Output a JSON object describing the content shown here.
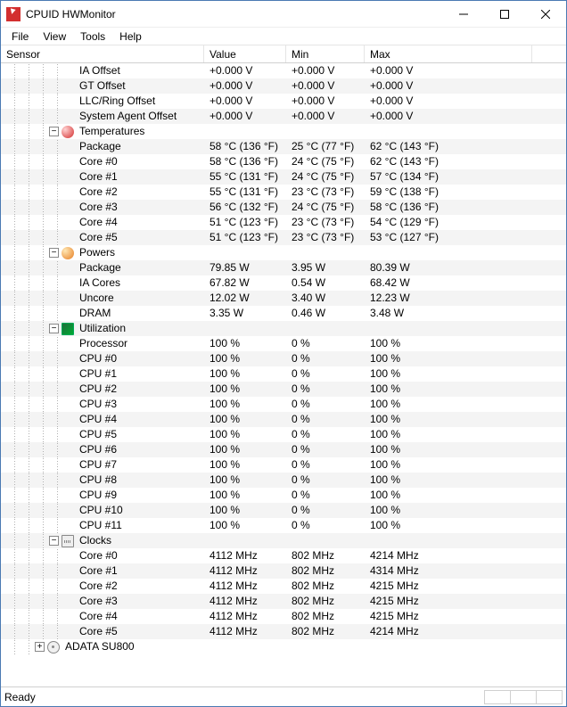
{
  "window": {
    "title": "CPUID HWMonitor"
  },
  "menu": {
    "file": "File",
    "view": "View",
    "tools": "Tools",
    "help": "Help"
  },
  "columns": {
    "sensor": "Sensor",
    "value": "Value",
    "min": "Min",
    "max": "Max"
  },
  "status": {
    "text": "Ready"
  },
  "rows": [
    {
      "kind": "leaf",
      "depth": 4,
      "label": "IA Offset",
      "value": "+0.000 V",
      "min": "+0.000 V",
      "max": "+0.000 V"
    },
    {
      "kind": "leaf",
      "depth": 4,
      "label": "GT Offset",
      "value": "+0.000 V",
      "min": "+0.000 V",
      "max": "+0.000 V"
    },
    {
      "kind": "leaf",
      "depth": 4,
      "label": "LLC/Ring Offset",
      "value": "+0.000 V",
      "min": "+0.000 V",
      "max": "+0.000 V"
    },
    {
      "kind": "leaf",
      "depth": 4,
      "label": "System Agent Offset",
      "value": "+0.000 V",
      "min": "+0.000 V",
      "max": "+0.000 V"
    },
    {
      "kind": "cat",
      "depth": 3,
      "icon": "temp",
      "label": "Temperatures"
    },
    {
      "kind": "leaf",
      "depth": 4,
      "label": "Package",
      "value": "58 °C  (136 °F)",
      "min": "25 °C  (77 °F)",
      "max": "62 °C  (143 °F)"
    },
    {
      "kind": "leaf",
      "depth": 4,
      "label": "Core #0",
      "value": "58 °C  (136 °F)",
      "min": "24 °C  (75 °F)",
      "max": "62 °C  (143 °F)"
    },
    {
      "kind": "leaf",
      "depth": 4,
      "label": "Core #1",
      "value": "55 °C  (131 °F)",
      "min": "24 °C  (75 °F)",
      "max": "57 °C  (134 °F)"
    },
    {
      "kind": "leaf",
      "depth": 4,
      "label": "Core #2",
      "value": "55 °C  (131 °F)",
      "min": "23 °C  (73 °F)",
      "max": "59 °C  (138 °F)"
    },
    {
      "kind": "leaf",
      "depth": 4,
      "label": "Core #3",
      "value": "56 °C  (132 °F)",
      "min": "24 °C  (75 °F)",
      "max": "58 °C  (136 °F)"
    },
    {
      "kind": "leaf",
      "depth": 4,
      "label": "Core #4",
      "value": "51 °C  (123 °F)",
      "min": "23 °C  (73 °F)",
      "max": "54 °C  (129 °F)"
    },
    {
      "kind": "leaf",
      "depth": 4,
      "label": "Core #5",
      "value": "51 °C  (123 °F)",
      "min": "23 °C  (73 °F)",
      "max": "53 °C  (127 °F)"
    },
    {
      "kind": "cat",
      "depth": 3,
      "icon": "power",
      "label": "Powers"
    },
    {
      "kind": "leaf",
      "depth": 4,
      "label": "Package",
      "value": "79.85 W",
      "min": "3.95 W",
      "max": "80.39 W"
    },
    {
      "kind": "leaf",
      "depth": 4,
      "label": "IA Cores",
      "value": "67.82 W",
      "min": "0.54 W",
      "max": "68.42 W"
    },
    {
      "kind": "leaf",
      "depth": 4,
      "label": "Uncore",
      "value": "12.02 W",
      "min": "3.40 W",
      "max": "12.23 W"
    },
    {
      "kind": "leaf",
      "depth": 4,
      "label": "DRAM",
      "value": "3.35 W",
      "min": "0.46 W",
      "max": "3.48 W"
    },
    {
      "kind": "cat",
      "depth": 3,
      "icon": "util",
      "label": "Utilization"
    },
    {
      "kind": "leaf",
      "depth": 4,
      "label": "Processor",
      "value": "100 %",
      "min": "0 %",
      "max": "100 %"
    },
    {
      "kind": "leaf",
      "depth": 4,
      "label": "CPU #0",
      "value": "100 %",
      "min": "0 %",
      "max": "100 %"
    },
    {
      "kind": "leaf",
      "depth": 4,
      "label": "CPU #1",
      "value": "100 %",
      "min": "0 %",
      "max": "100 %"
    },
    {
      "kind": "leaf",
      "depth": 4,
      "label": "CPU #2",
      "value": "100 %",
      "min": "0 %",
      "max": "100 %"
    },
    {
      "kind": "leaf",
      "depth": 4,
      "label": "CPU #3",
      "value": "100 %",
      "min": "0 %",
      "max": "100 %"
    },
    {
      "kind": "leaf",
      "depth": 4,
      "label": "CPU #4",
      "value": "100 %",
      "min": "0 %",
      "max": "100 %"
    },
    {
      "kind": "leaf",
      "depth": 4,
      "label": "CPU #5",
      "value": "100 %",
      "min": "0 %",
      "max": "100 %"
    },
    {
      "kind": "leaf",
      "depth": 4,
      "label": "CPU #6",
      "value": "100 %",
      "min": "0 %",
      "max": "100 %"
    },
    {
      "kind": "leaf",
      "depth": 4,
      "label": "CPU #7",
      "value": "100 %",
      "min": "0 %",
      "max": "100 %"
    },
    {
      "kind": "leaf",
      "depth": 4,
      "label": "CPU #8",
      "value": "100 %",
      "min": "0 %",
      "max": "100 %"
    },
    {
      "kind": "leaf",
      "depth": 4,
      "label": "CPU #9",
      "value": "100 %",
      "min": "0 %",
      "max": "100 %"
    },
    {
      "kind": "leaf",
      "depth": 4,
      "label": "CPU #10",
      "value": "100 %",
      "min": "0 %",
      "max": "100 %"
    },
    {
      "kind": "leaf",
      "depth": 4,
      "label": "CPU #11",
      "value": "100 %",
      "min": "0 %",
      "max": "100 %"
    },
    {
      "kind": "cat",
      "depth": 3,
      "icon": "clock",
      "label": "Clocks"
    },
    {
      "kind": "leaf",
      "depth": 4,
      "label": "Core #0",
      "value": "4112 MHz",
      "min": "802 MHz",
      "max": "4214 MHz"
    },
    {
      "kind": "leaf",
      "depth": 4,
      "label": "Core #1",
      "value": "4112 MHz",
      "min": "802 MHz",
      "max": "4314 MHz"
    },
    {
      "kind": "leaf",
      "depth": 4,
      "label": "Core #2",
      "value": "4112 MHz",
      "min": "802 MHz",
      "max": "4215 MHz"
    },
    {
      "kind": "leaf",
      "depth": 4,
      "label": "Core #3",
      "value": "4112 MHz",
      "min": "802 MHz",
      "max": "4215 MHz"
    },
    {
      "kind": "leaf",
      "depth": 4,
      "label": "Core #4",
      "value": "4112 MHz",
      "min": "802 MHz",
      "max": "4215 MHz"
    },
    {
      "kind": "leaf",
      "depth": 4,
      "label": "Core #5",
      "value": "4112 MHz",
      "min": "802 MHz",
      "max": "4214 MHz"
    },
    {
      "kind": "cat",
      "depth": 2,
      "icon": "disk",
      "label": "ADATA SU800",
      "toggle": "+"
    }
  ]
}
